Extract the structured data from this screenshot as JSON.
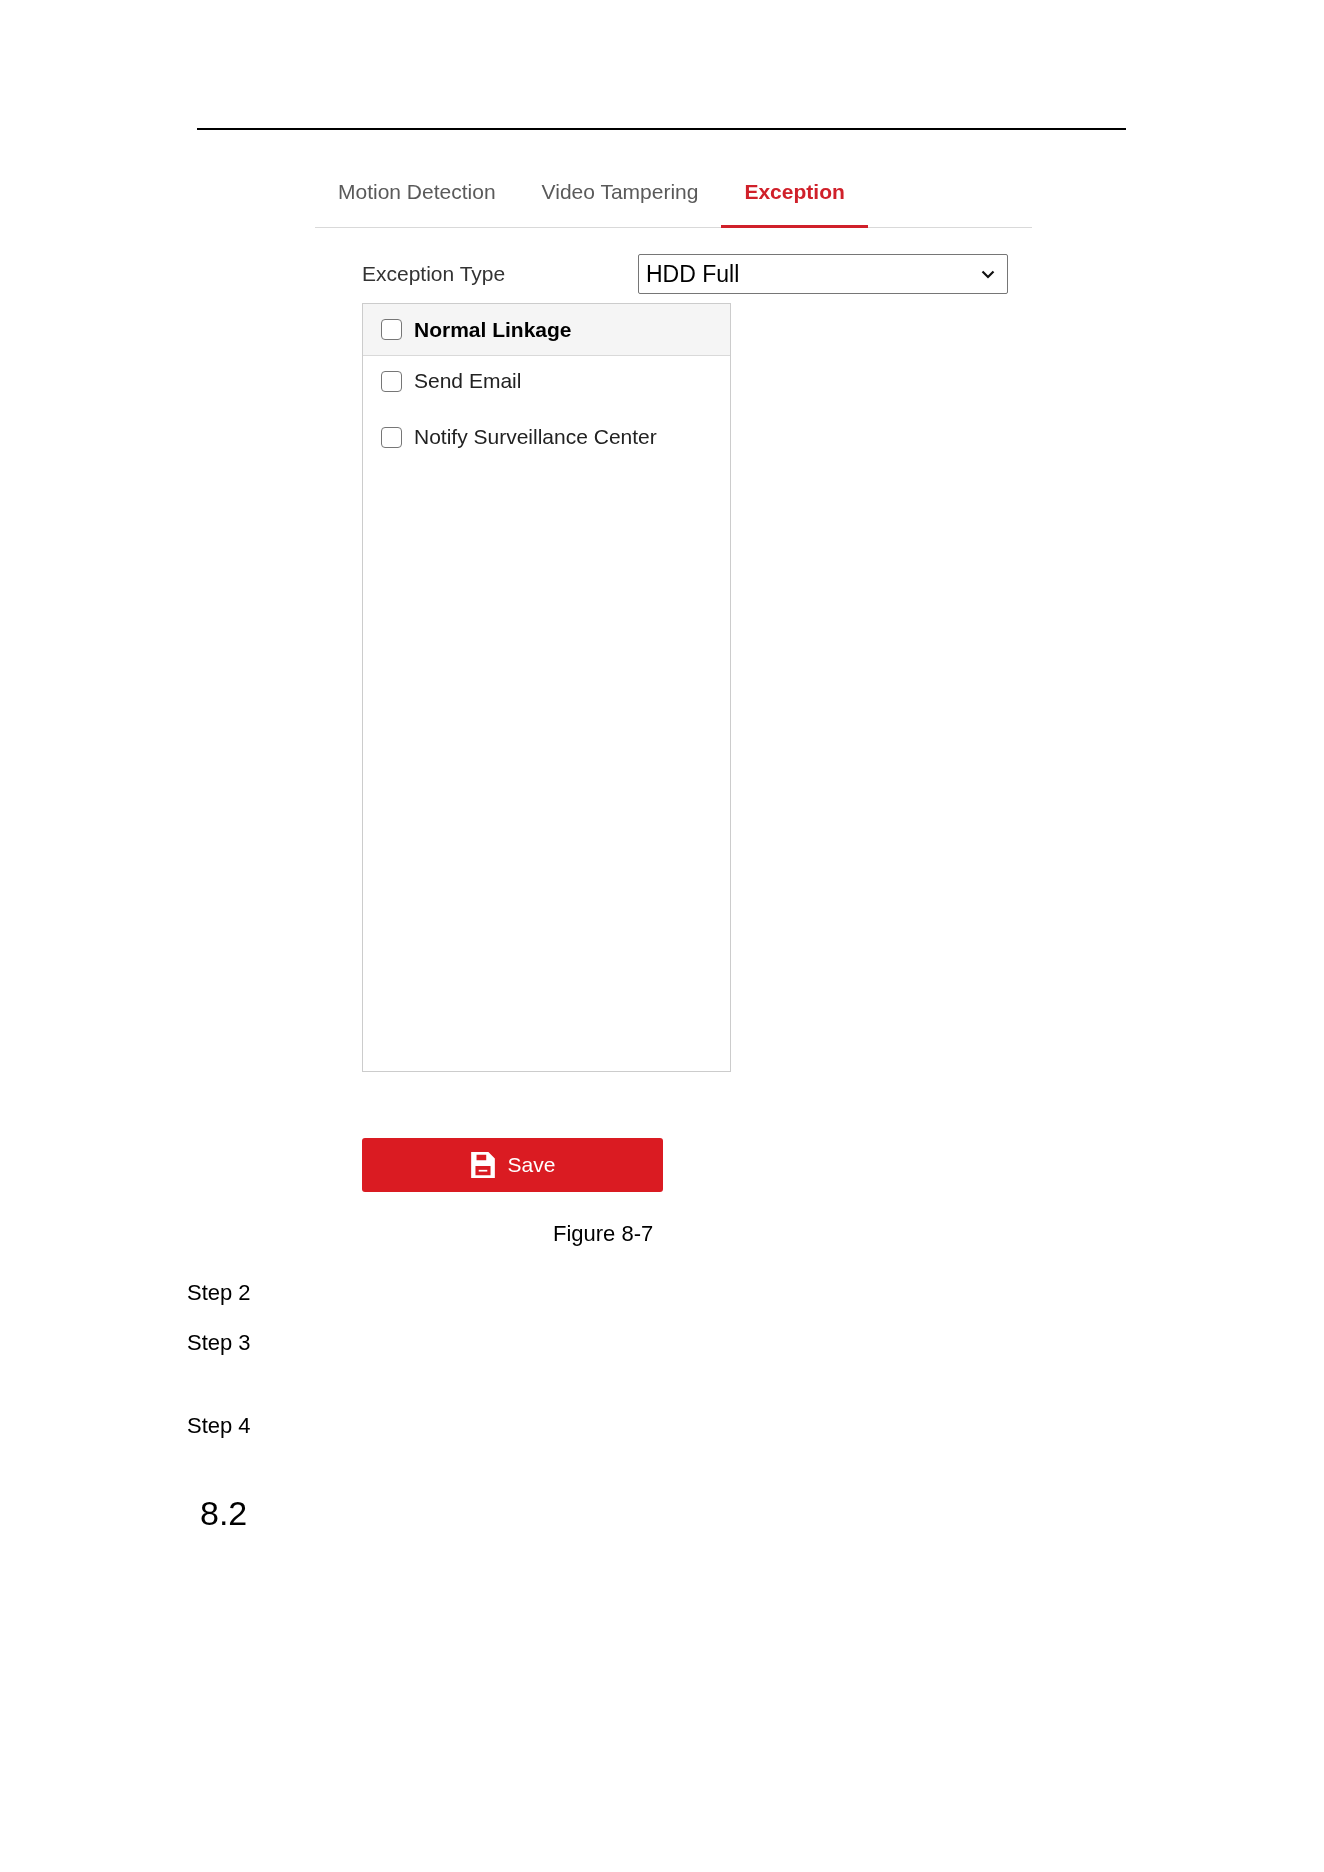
{
  "tabs": [
    {
      "label": "Motion Detection",
      "selected": false
    },
    {
      "label": "Video Tampering",
      "selected": false
    },
    {
      "label": "Exception",
      "selected": true
    }
  ],
  "exception_type": {
    "label": "Exception Type",
    "value": "HDD Full"
  },
  "linkage": {
    "header": {
      "label": "Normal Linkage",
      "checked": false
    },
    "items": [
      {
        "label": "Send Email",
        "checked": false
      },
      {
        "label": "Notify Surveillance Center",
        "checked": false
      }
    ]
  },
  "save_button": {
    "label": "Save"
  },
  "figure_caption": "Figure 8-7",
  "steps": [
    "Step 2",
    "Step 3",
    "Step 4"
  ],
  "section_number": "8.2"
}
